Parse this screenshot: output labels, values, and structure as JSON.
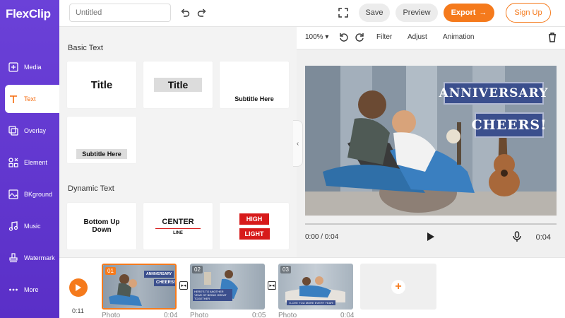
{
  "app": {
    "logo": "FlexClip"
  },
  "sidebar": {
    "items": [
      {
        "label": "Media",
        "icon": "media-icon"
      },
      {
        "label": "Text",
        "icon": "text-icon"
      },
      {
        "label": "Overlay",
        "icon": "overlay-icon"
      },
      {
        "label": "Element",
        "icon": "element-icon"
      },
      {
        "label": "BKground",
        "icon": "background-icon"
      },
      {
        "label": "Music",
        "icon": "music-icon"
      },
      {
        "label": "Watermark",
        "icon": "watermark-icon"
      },
      {
        "label": "More",
        "icon": "more-icon"
      }
    ]
  },
  "topbar": {
    "title_placeholder": "Untitled",
    "save": "Save",
    "preview": "Preview",
    "export": "Export",
    "signup": "Sign Up"
  },
  "panel": {
    "basic_heading": "Basic Text",
    "dynamic_heading": "Dynamic Text",
    "basic_cards": [
      "Title",
      "Title",
      "Subtitle Here",
      "Subtitle Here"
    ],
    "dynamic_cards": {
      "bottom_up_line1": "Bottom Up",
      "bottom_up_line2": "Down",
      "center": "CENTER",
      "center_sub": "LINE",
      "high": "HIGH",
      "light": "LIGHT"
    }
  },
  "editor": {
    "zoom": "100%",
    "filter": "Filter",
    "adjust": "Adjust",
    "animation": "Animation",
    "banner_1": "ANNIVERSARY",
    "banner_2": "CHEERS!",
    "time_current": "0:00 / 0:04",
    "time_total": "0:04",
    "progress": 0
  },
  "timeline": {
    "current_time": "0:11",
    "clips": [
      {
        "num": "01",
        "label": "Photo",
        "duration": "0:04",
        "banner_1": "ANNIVERSARY",
        "banner_2": "CHEERS!"
      },
      {
        "num": "02",
        "label": "Photo",
        "duration": "0:05",
        "caption": "HERE'S TO ANOTHER YEAR OF BEING GREAT TOGETHER"
      },
      {
        "num": "03",
        "label": "Photo",
        "duration": "0:04",
        "caption": "I LOVE YOU MORE EVERY YEAR!"
      }
    ]
  },
  "colors": {
    "accent": "#f57a1c",
    "sidebar": "#6b41d8",
    "banner": "#3b4f8d",
    "high_light": "#d71a1a"
  }
}
